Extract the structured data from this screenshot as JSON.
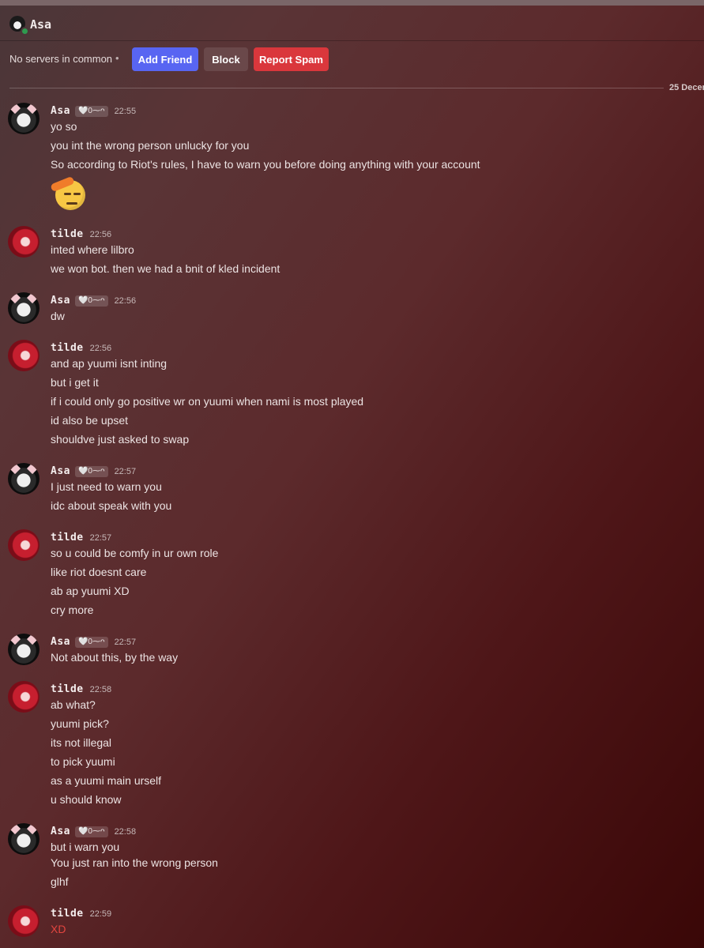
{
  "header": {
    "title": "Asa"
  },
  "actions": {
    "no_servers": "No servers in common",
    "separator": "•",
    "add_friend": "Add Friend",
    "block": "Block",
    "report_spam": "Report Spam"
  },
  "divider": {
    "date": "25 Decem"
  },
  "users": {
    "asa": "Asa",
    "tilde": "tilde",
    "asa_tag": "🤍0⁓ᴖ"
  },
  "messages": [
    {
      "author": "Asa",
      "time": "22:55",
      "lines": [
        "yo so",
        "you int the wrong person unlucky for you",
        "So according to Riot's rules, I have to warn you before doing anything with your account"
      ],
      "emoji": "saluting-face-emoji"
    },
    {
      "author": "tilde",
      "time": "22:56",
      "lines": [
        "inted where lilbro",
        "we won bot. then we had a bnit of kled incident"
      ]
    },
    {
      "author": "Asa",
      "time": "22:56",
      "lines": [
        "dw"
      ]
    },
    {
      "author": "tilde",
      "time": "22:56",
      "lines": [
        "and ap yuumi isnt inting",
        "but i get it",
        "if i could only go positive wr on yuumi when nami is most played",
        "id also be upset",
        "shouldve just asked to swap"
      ]
    },
    {
      "author": "Asa",
      "time": "22:57",
      "lines": [
        "I just need to warn you",
        "idc about speak with you"
      ]
    },
    {
      "author": "tilde",
      "time": "22:57",
      "lines": [
        "so u could be comfy in ur own role",
        "like riot doesnt care",
        "ab ap yuumi XD",
        "cry more"
      ]
    },
    {
      "author": "Asa",
      "time": "22:57",
      "lines": [
        "Not about this, by the way"
      ]
    },
    {
      "author": "tilde",
      "time": "22:58",
      "lines": [
        "ab what?",
        "yuumi pick?",
        "its not illegal",
        "to pick yuumi",
        "as a yuumi main urself",
        "u should know"
      ]
    },
    {
      "author": "Asa",
      "time": "22:58",
      "lines": [
        "but i warn you",
        "You just ran into the wrong person",
        "glhf"
      ]
    },
    {
      "author": "tilde",
      "time": "22:59",
      "lines": [
        "XD"
      ]
    }
  ],
  "colors": {
    "add_friend": "#5865f2",
    "report_spam": "#da373c",
    "xd_text": "#e3453f"
  }
}
